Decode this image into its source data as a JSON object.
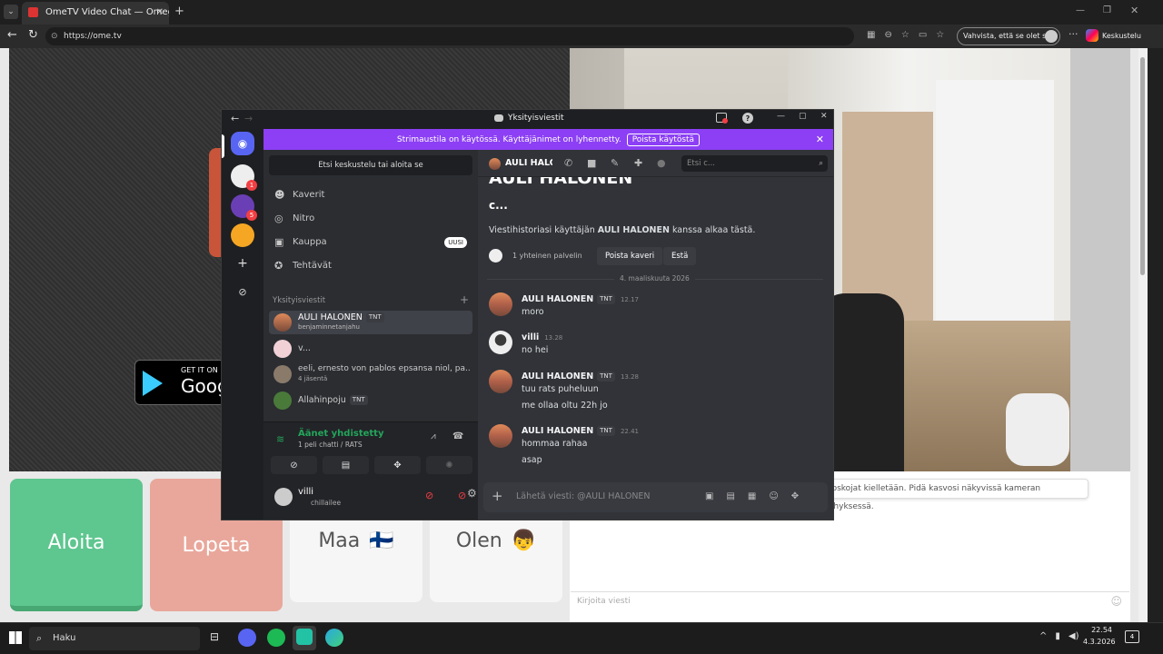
{
  "browser": {
    "tab_title": "OmeTV Video Chat — Omeg",
    "url": "https://ome.tv",
    "confirm_label": "Vahvista, että se olet sinä",
    "copilot_label": "Keskustelu"
  },
  "page": {
    "google_play_small": "GET IT ON",
    "google_play_big": "Goog",
    "buttons": {
      "start": "Aloita",
      "stop": "Lopeta",
      "country": "Maa",
      "country_flag": "🇫🇮",
      "gender": "Olen",
      "gender_icon": "👦"
    },
    "warning": "...oskojat kielletään. Pidä kasvosi näkyvissä kameran kehyksessä.",
    "message_placeholder": "Kirjoita viesti"
  },
  "discord": {
    "title": "Yksityisviestit",
    "banner_text": "Strimaustila on käytössä. Käyttäjänimet on lyhennetty.",
    "banner_button": "Poista käytöstä",
    "search_placeholder": "Etsi keskustelu tai aloita se",
    "nav": [
      {
        "label": "Kaverit",
        "icon": "friends-icon"
      },
      {
        "label": "Nitro",
        "icon": "nitro-icon"
      },
      {
        "label": "Kauppa",
        "icon": "shop-icon",
        "badge": "UUSI"
      },
      {
        "label": "Tehtävät",
        "icon": "quests-icon"
      }
    ],
    "dm_section": "Yksityisviestit",
    "dms": [
      {
        "name": "AULI HALONEN",
        "tag": "TNT",
        "sub": "benjaminnetanjahu",
        "selected": true
      },
      {
        "name": "v...",
        "tag": "",
        "sub": ""
      },
      {
        "name": "eeli, ernesto von pablos epsansa niol, pa...",
        "tag": "",
        "sub": "4 jäsentä"
      },
      {
        "name": "Allahinpoju",
        "tag": "TNT",
        "sub": ""
      }
    ],
    "server_badges": {
      "s1": "1",
      "s2": "5"
    },
    "voice": {
      "status": "Äänet yhdistetty",
      "channel": "1 peli chatti / RATS"
    },
    "user": {
      "name": "villi",
      "status": "chillailee"
    },
    "main": {
      "header_name": "AULI HALONEN",
      "header_search": "Etsi c...",
      "big_name": "AULI HALONEN",
      "subname": "c...",
      "history_prefix": "Viestihistoriasi käyttäjän ",
      "history_name": "AULI HALONEN",
      "history_suffix": " kanssa alkaa tästä.",
      "mutual": "1 yhteinen palvelin",
      "remove_friend": "Poista kaveri",
      "block": "Estä",
      "date_divider": "4. maaliskuuta 2026",
      "messages": [
        {
          "author": "AULI HALONEN",
          "tag": "TNT",
          "time": "12.17",
          "lines": [
            "moro"
          ]
        },
        {
          "author": "villi",
          "tag": "",
          "time": "13.28",
          "lines": [
            "no hei"
          ]
        },
        {
          "author": "AULI HALONEN",
          "tag": "TNT",
          "time": "13.28",
          "lines": [
            "tuu rats puheluun",
            "me ollaa oltu 22h jo"
          ]
        },
        {
          "author": "AULI HALONEN",
          "tag": "TNT",
          "time": "22.41",
          "lines": [
            "hommaa rahaa",
            "asap"
          ]
        }
      ],
      "composer_placeholder": "Lähetä viesti: @AULI HALONEN"
    }
  },
  "taskbar": {
    "search": "Haku",
    "time": "22.54",
    "date": "4.3.2026",
    "notif_count": "4"
  }
}
